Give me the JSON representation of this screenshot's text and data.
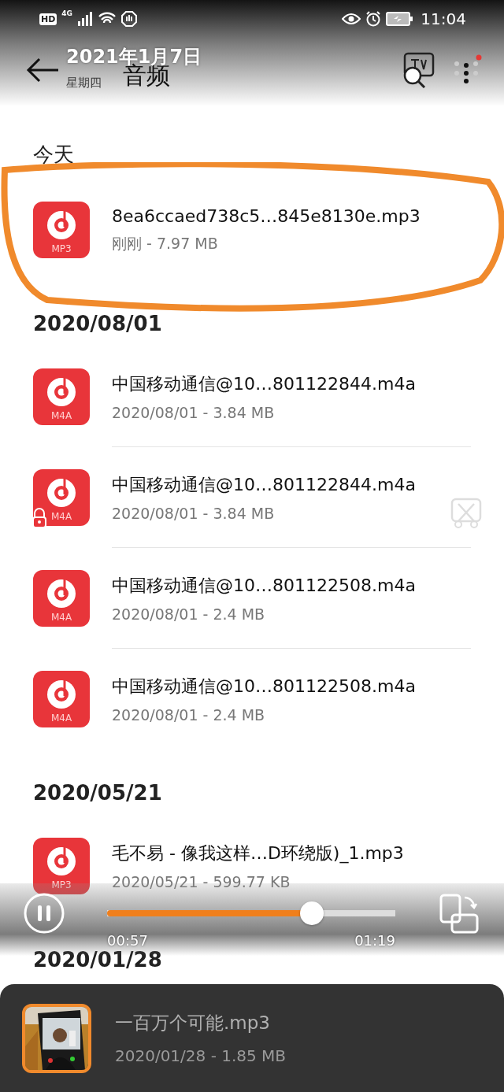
{
  "status_bar": {
    "hd": "HD",
    "network": "4G",
    "time": "11:04"
  },
  "date_overlay": {
    "date": "2021年1月7日",
    "weekday": "星期四"
  },
  "header": {
    "title": "音频",
    "has_notification": true
  },
  "sections": [
    {
      "heading": "今天",
      "files": [
        {
          "name": "8ea6ccaed738c5…845e8130e.mp3",
          "meta": "刚刚 - 7.97 MB",
          "badge": "MP3"
        }
      ]
    },
    {
      "heading": "2020/08/01",
      "files": [
        {
          "name": "中国移动通信@10…801122844.m4a",
          "meta": "2020/08/01 - 3.84 MB",
          "badge": "M4A"
        },
        {
          "name": "中国移动通信@10…801122844.m4a",
          "meta": "2020/08/01 - 3.84 MB",
          "badge": "M4A"
        },
        {
          "name": "中国移动通信@10…801122508.m4a",
          "meta": "2020/08/01 - 2.4 MB",
          "badge": "M4A"
        },
        {
          "name": "中国移动通信@10…801122508.m4a",
          "meta": "2020/08/01 - 2.4 MB",
          "badge": "M4A"
        }
      ]
    },
    {
      "heading": "2020/05/21",
      "files": [
        {
          "name": "毛不易 - 像我这样…D环绕版)_1.mp3",
          "meta": "2020/05/21 - 599.77 KB",
          "badge": "MP3"
        }
      ]
    },
    {
      "heading": "2020/01/28"
    }
  ],
  "player": {
    "playing": true,
    "level": 0.71,
    "elapsed": "00:57",
    "duration": "01:19"
  },
  "now_playing": {
    "name": "一百万个可能.mp3",
    "meta": "2020/01/28 - 1.85 MB",
    "kind": "picture"
  }
}
